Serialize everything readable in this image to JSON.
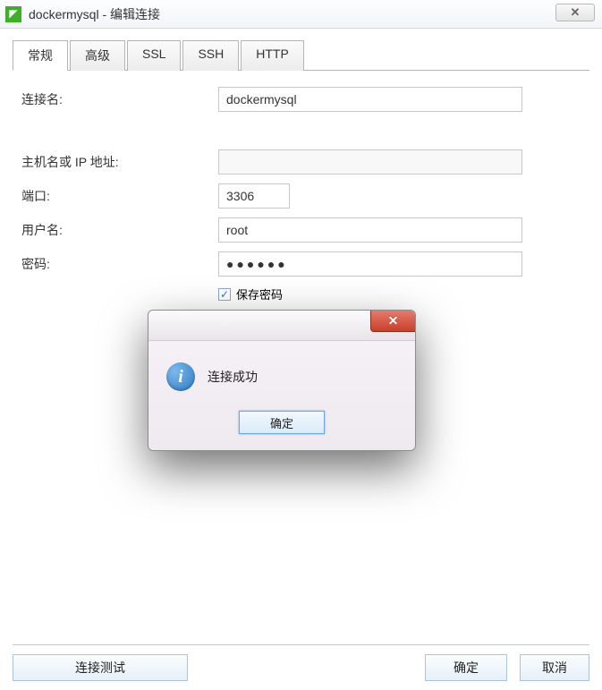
{
  "window": {
    "title": "dockermysql - 编辑连接"
  },
  "tabs": {
    "general": "常规",
    "advanced": "高级",
    "ssl": "SSL",
    "ssh": "SSH",
    "http": "HTTP"
  },
  "form": {
    "connection_name_label": "连接名:",
    "connection_name_value": "dockermysql",
    "host_label": "主机名或 IP 地址:",
    "host_value": "",
    "port_label": "端口:",
    "port_value": "3306",
    "username_label": "用户名:",
    "username_value": "root",
    "password_label": "密码:",
    "password_value": "●●●●●●",
    "save_password_label": "保存密码"
  },
  "dialog": {
    "message": "连接成功",
    "ok_label": "确定"
  },
  "buttons": {
    "test_connection": "连接测试",
    "ok": "确定",
    "cancel": "取消"
  }
}
